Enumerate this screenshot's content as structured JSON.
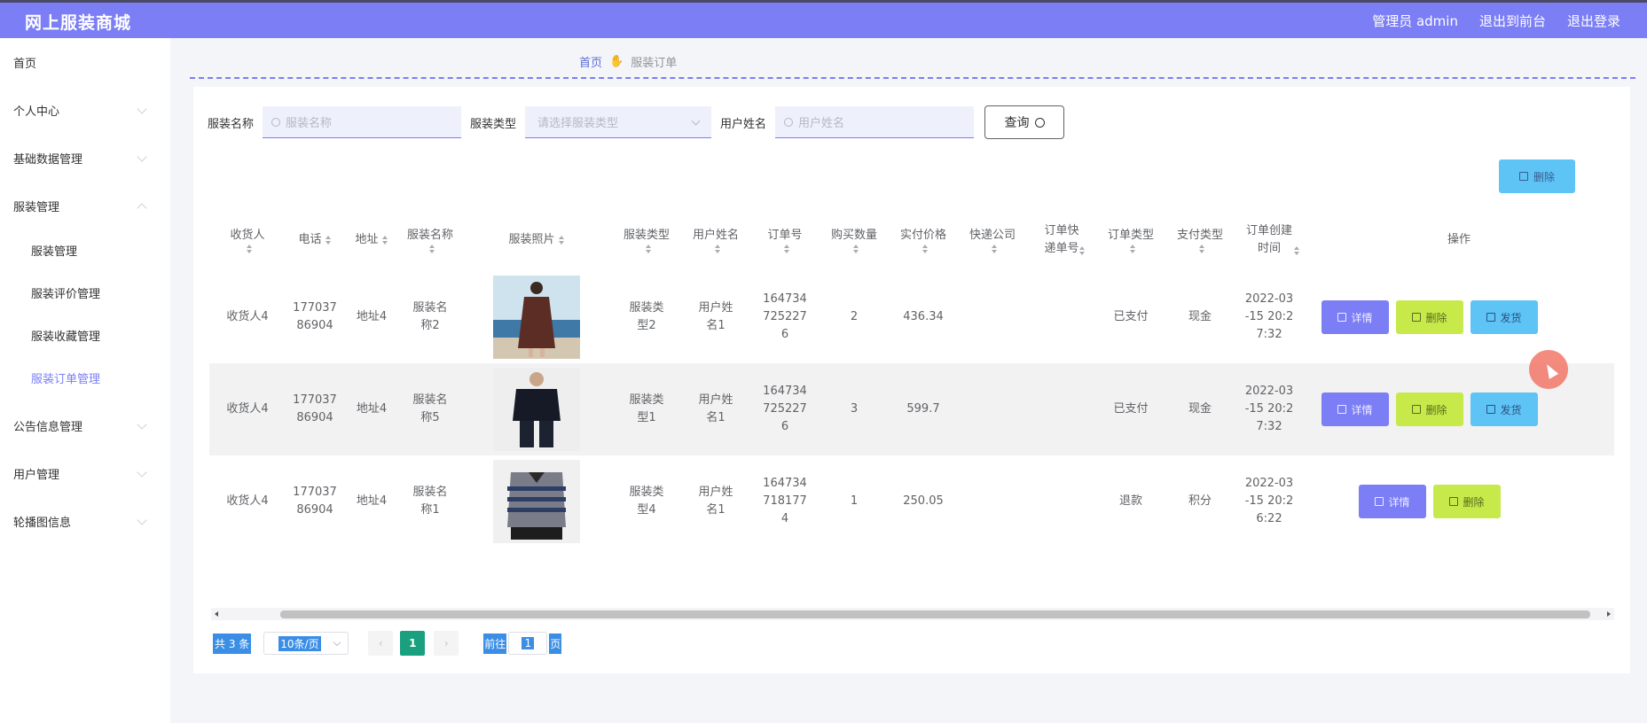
{
  "header": {
    "app_title": "网上服装商城",
    "user_label": "管理员 admin",
    "to_front": "退出到前台",
    "logout": "退出登录"
  },
  "sidebar": {
    "items": [
      {
        "label": "首页"
      },
      {
        "label": "个人中心"
      },
      {
        "label": "基础数据管理"
      },
      {
        "label": "服装管理"
      },
      {
        "label": "服装管理"
      },
      {
        "label": "服装评价管理"
      },
      {
        "label": "服装收藏管理"
      },
      {
        "label": "服装订单管理"
      },
      {
        "label": "公告信息管理"
      },
      {
        "label": "用户管理"
      },
      {
        "label": "轮播图信息"
      }
    ]
  },
  "breadcrumb": {
    "home": "首页",
    "current": "服装订单"
  },
  "search": {
    "name_label": "服装名称",
    "name_placeholder": "服装名称",
    "type_label": "服装类型",
    "type_placeholder": "请选择服装类型",
    "user_label": "用户姓名",
    "user_placeholder": "用户姓名",
    "query_button": "查询"
  },
  "toolbar": {
    "delete_label": "删除"
  },
  "table": {
    "headers": [
      "收货人",
      "电话",
      "地址",
      "服装名称",
      "服装照片",
      "服装类型",
      "用户姓名",
      "订单号",
      "购买数量",
      "实付价格",
      "快递公司",
      "订单快递单号",
      "订单类型",
      "支付类型",
      "订单创建时间",
      "操作"
    ],
    "rows": [
      {
        "receiver": "收货人4",
        "phone": "17703786904",
        "address": "地址4",
        "name": "服装名称2",
        "type": "服装类型2",
        "user": "用户姓名1",
        "order_no": "1647347252276",
        "qty": "2",
        "price": "436.34",
        "courier": "",
        "tracking": "",
        "status": "已支付",
        "pay": "现金",
        "created": "2022-03-15 20:27:32",
        "actions": [
          "详情",
          "删除",
          "发货"
        ]
      },
      {
        "receiver": "收货人4",
        "phone": "17703786904",
        "address": "地址4",
        "name": "服装名称5",
        "type": "服装类型1",
        "user": "用户姓名1",
        "order_no": "1647347252276",
        "qty": "3",
        "price": "599.7",
        "courier": "",
        "tracking": "",
        "status": "已支付",
        "pay": "现金",
        "created": "2022-03-15 20:27:32",
        "actions": [
          "详情",
          "删除",
          "发货"
        ]
      },
      {
        "receiver": "收货人4",
        "phone": "17703786904",
        "address": "地址4",
        "name": "服装名称1",
        "type": "服装类型4",
        "user": "用户姓名1",
        "order_no": "1647347181774",
        "qty": "1",
        "price": "250.05",
        "courier": "",
        "tracking": "",
        "status": "退款",
        "pay": "积分",
        "created": "2022-03-15 20:26:22",
        "actions": [
          "详情",
          "删除"
        ]
      }
    ]
  },
  "pagination": {
    "total": "共 3 条",
    "page_size": "10条/页",
    "current_page": "1",
    "goto_prefix": "前往",
    "goto_value": "1",
    "goto_suffix": "页"
  },
  "colors": {
    "accent": "#7b7ef4",
    "delete": "#c7e94a",
    "ship": "#5ec4f5",
    "pager_active": "#1aa07e"
  }
}
